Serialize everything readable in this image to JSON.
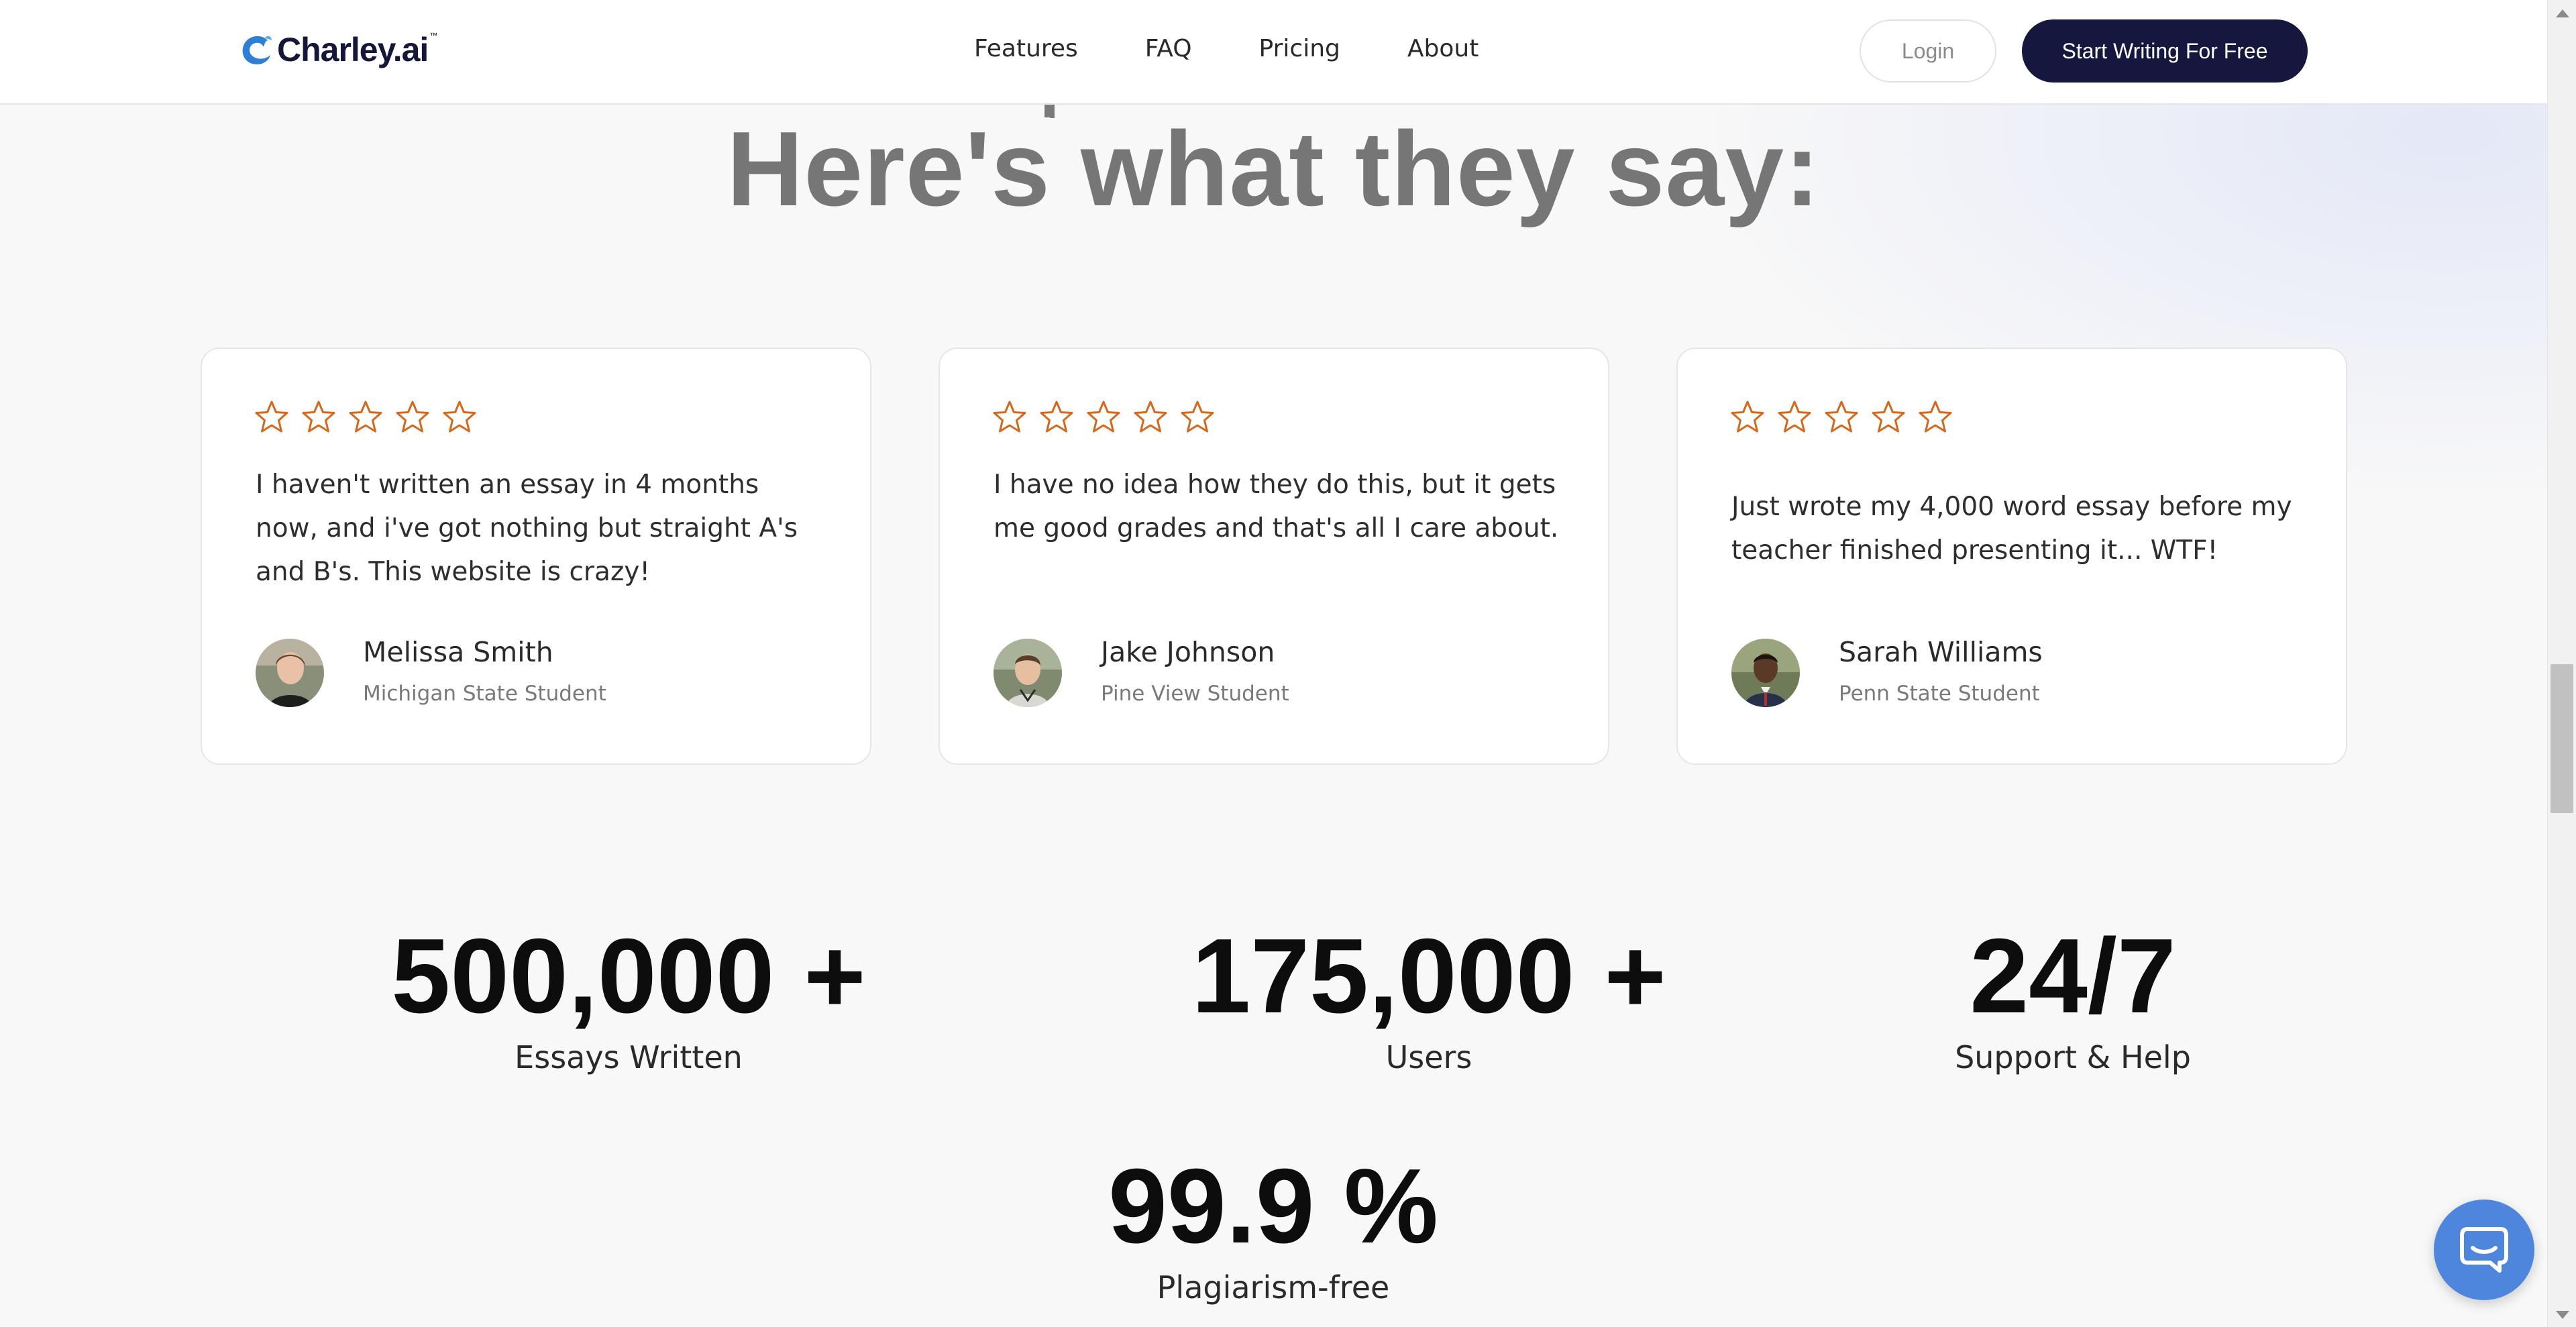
{
  "header": {
    "logo_text": "Charley.ai",
    "logo_tm": "™",
    "nav": [
      "Features",
      "FAQ",
      "Pricing",
      "About"
    ],
    "login_label": "Login",
    "cta_label": "Start Writing For Free"
  },
  "heading": {
    "prev_line_fragment": ",",
    "title": "Here's what they say:"
  },
  "testimonials": [
    {
      "rating": 5,
      "quote": "I haven't written an essay in 4 months now, and i've got nothing but straight A's and B's. This website is crazy!",
      "name": "Melissa Smith",
      "role": "Michigan State Student"
    },
    {
      "rating": 5,
      "quote": "I have no idea how they do this, but it gets me good grades and that's all I care about.",
      "name": "Jake Johnson",
      "role": "Pine View Student"
    },
    {
      "rating": 5,
      "quote": "Just wrote my 4,000 word essay before my teacher finished presenting it... WTF!",
      "name": "Sarah Williams",
      "role": "Penn State Student"
    }
  ],
  "stats": [
    {
      "value": "500,000 +",
      "label": "Essays Written"
    },
    {
      "value": "175,000 +",
      "label": "Users"
    },
    {
      "value": "24/7",
      "label": "Support & Help"
    },
    {
      "value": "99.9 %",
      "label": "Plagiarism-free"
    }
  ],
  "colors": {
    "brand_navy": "#16173f",
    "star_orange": "#d2691e",
    "chat_blue": "#4d86dc",
    "heading_gray": "#767676"
  },
  "icons": {
    "star": "star-outline-icon",
    "chat": "chat-bubble-icon",
    "logo": "charley-wave-logo-icon"
  }
}
